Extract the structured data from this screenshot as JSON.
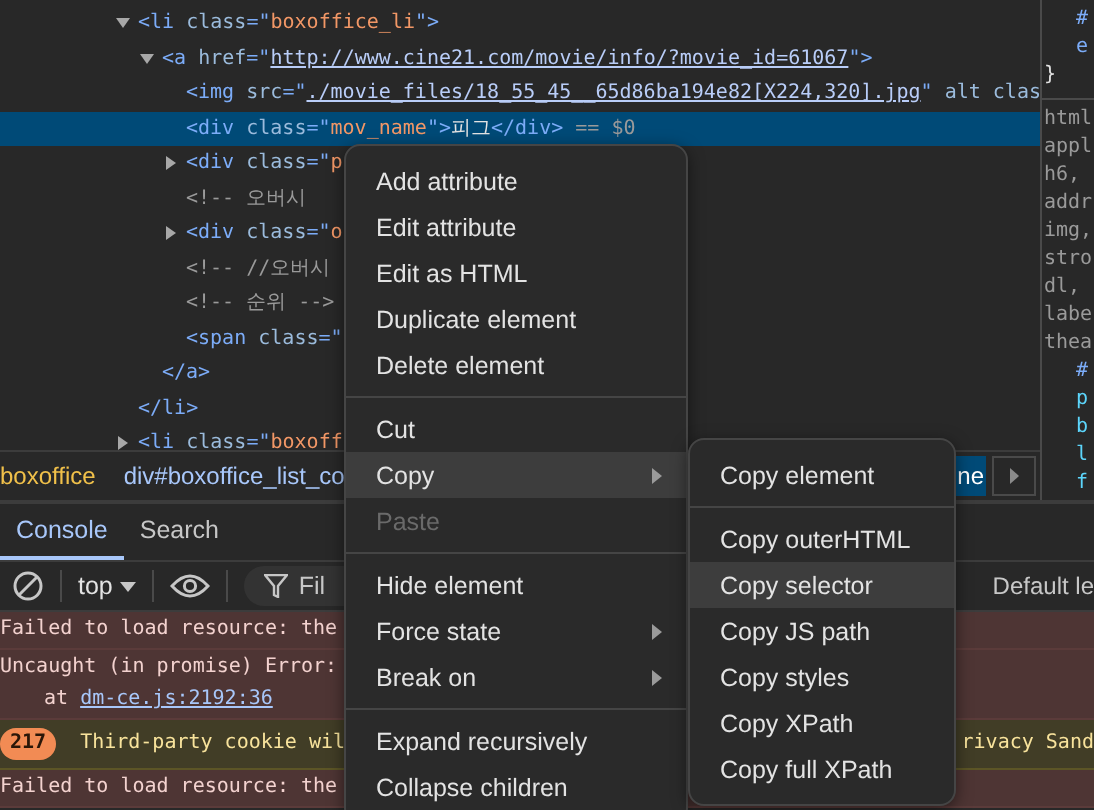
{
  "dom_tree": [
    {
      "selected": false,
      "expanded": true,
      "tokens": [
        {
          "kind": "tag",
          "text": "<li"
        },
        {
          "kind": "attr",
          "text": " class"
        },
        {
          "kind": "tag",
          "text": "=\""
        },
        {
          "kind": "value",
          "text": "boxoffice_li"
        },
        {
          "kind": "tag",
          "text": "\">"
        }
      ],
      "closing": "</li>",
      "children": [
        {
          "selected": false,
          "expanded": true,
          "tokens": [
            {
              "kind": "tag",
              "text": "<a"
            },
            {
              "kind": "attr",
              "text": " href"
            },
            {
              "kind": "tag",
              "text": "=\""
            },
            {
              "kind": "link",
              "text": "http://www.cine21.com/movie/info/?movie_id=61067"
            },
            {
              "kind": "tag",
              "text": "\">"
            }
          ],
          "closing": "</a>",
          "children": [
            {
              "selected": false,
              "tokens": [
                {
                  "kind": "tag",
                  "text": "<img"
                },
                {
                  "kind": "attr",
                  "text": " src"
                },
                {
                  "kind": "tag",
                  "text": "=\""
                },
                {
                  "kind": "link",
                  "text": "./movie_files/18_55_45__65d86ba194e82[X224,320].jpg"
                },
                {
                  "kind": "tag",
                  "text": "\""
                },
                {
                  "kind": "attr",
                  "text": " alt clas"
                }
              ]
            },
            {
              "selected": true,
              "tokens": [
                {
                  "kind": "tag",
                  "text": "<div"
                },
                {
                  "kind": "attr",
                  "text": " class"
                },
                {
                  "kind": "tag",
                  "text": "=\""
                },
                {
                  "kind": "value",
                  "text": "mov_name"
                },
                {
                  "kind": "tag",
                  "text": "\">"
                },
                {
                  "kind": "text",
                  "text": "피그"
                },
                {
                  "kind": "tag",
                  "text": "</div>"
                },
                {
                  "kind": "marker",
                  "text": " == $0"
                }
              ]
            },
            {
              "selected": false,
              "expanded": false,
              "tokens": [
                {
                  "kind": "tag",
                  "text": "<div"
                },
                {
                  "kind": "attr",
                  "text": " class"
                },
                {
                  "kind": "tag",
                  "text": "=\""
                },
                {
                  "kind": "value",
                  "text": "p"
                }
              ]
            },
            {
              "selected": false,
              "tokens": [
                {
                  "kind": "comment",
                  "text": "<!-- 오버시"
                }
              ]
            },
            {
              "selected": false,
              "expanded": false,
              "tokens": [
                {
                  "kind": "tag",
                  "text": "<div"
                },
                {
                  "kind": "attr",
                  "text": " class"
                },
                {
                  "kind": "tag",
                  "text": "=\""
                },
                {
                  "kind": "value",
                  "text": "o"
                }
              ]
            },
            {
              "selected": false,
              "tokens": [
                {
                  "kind": "comment",
                  "text": "<!-- //오버시"
                }
              ]
            },
            {
              "selected": false,
              "tokens": [
                {
                  "kind": "comment",
                  "text": "<!-- 순위 -->"
                }
              ]
            },
            {
              "selected": false,
              "tokens": [
                {
                  "kind": "tag",
                  "text": "<span"
                },
                {
                  "kind": "attr",
                  "text": " class"
                },
                {
                  "kind": "tag",
                  "text": "=\""
                }
              ]
            }
          ]
        }
      ]
    },
    {
      "selected": false,
      "expanded": false,
      "tokens": [
        {
          "kind": "tag",
          "text": "<li"
        },
        {
          "kind": "attr",
          "text": " class"
        },
        {
          "kind": "tag",
          "text": "=\""
        },
        {
          "kind": "value",
          "text": "boxoff"
        }
      ]
    }
  ],
  "breadcrumbs": [
    {
      "text": "boxoffice",
      "kind": "id",
      "selected": false
    },
    {
      "text": "div#boxoffice_list_co",
      "kind": "element",
      "selected": false
    },
    {
      "text": "ne",
      "kind": "element",
      "selected": true
    }
  ],
  "styles_pane": {
    "sections": [
      {
        "lines": [
          {
            "kind": "declaration",
            "text": "#"
          },
          {
            "kind": "declaration",
            "text": "e"
          },
          {
            "kind": "brace",
            "text": "}"
          }
        ]
      },
      {
        "lines": [
          {
            "kind": "user_agent",
            "text": "html"
          },
          {
            "kind": "user_agent",
            "text": "appl"
          },
          {
            "kind": "user_agent",
            "text": "h6,"
          },
          {
            "kind": "user_agent",
            "text": "addr"
          },
          {
            "kind": "user_agent",
            "text": "img,"
          },
          {
            "kind": "user_agent",
            "text": "stro"
          },
          {
            "kind": "user_agent",
            "text": "dl,"
          },
          {
            "kind": "user_agent",
            "text": "labe"
          },
          {
            "kind": "user_agent",
            "text": "thea"
          },
          {
            "kind": "declaration",
            "text": "#"
          },
          {
            "kind": "property",
            "text": "p"
          },
          {
            "kind": "property",
            "text": "b"
          },
          {
            "kind": "property",
            "text": "l"
          },
          {
            "kind": "property",
            "text": "f"
          }
        ]
      }
    ]
  },
  "drawer_tabs": [
    {
      "label": "Console",
      "selected": true
    },
    {
      "label": "Search",
      "selected": false
    }
  ],
  "console_toolbar": {
    "context": "top",
    "filter": {
      "placeholder": "Fil"
    },
    "levels": "Default le"
  },
  "console_messages": [
    {
      "kind": "error",
      "text": "Failed to load resource: the"
    },
    {
      "kind": "error",
      "text": "Uncaught (in promise) Error:",
      "stack_prefix": "at",
      "stack_link": "dm-ce.js:2192:36"
    },
    {
      "kind": "warning",
      "count": "217",
      "text": "Third-party cookie wil",
      "text_right": "rivacy Sand"
    },
    {
      "kind": "error",
      "text": "Failed to load resource: the"
    }
  ],
  "context_menu": {
    "groups": [
      [
        {
          "label": "Add attribute",
          "selected": false,
          "disabled": false,
          "submenu": false
        },
        {
          "label": "Edit attribute",
          "selected": false,
          "disabled": false,
          "submenu": false
        },
        {
          "label": "Edit as HTML",
          "selected": false,
          "disabled": false,
          "submenu": false
        },
        {
          "label": "Duplicate element",
          "selected": false,
          "disabled": false,
          "submenu": false
        },
        {
          "label": "Delete element",
          "selected": false,
          "disabled": false,
          "submenu": false
        }
      ],
      [
        {
          "label": "Cut",
          "selected": false,
          "disabled": false,
          "submenu": false
        },
        {
          "label": "Copy",
          "selected": true,
          "disabled": false,
          "submenu": true
        },
        {
          "label": "Paste",
          "selected": false,
          "disabled": true,
          "submenu": false
        }
      ],
      [
        {
          "label": "Hide element",
          "selected": false,
          "disabled": false,
          "submenu": false
        },
        {
          "label": "Force state",
          "selected": false,
          "disabled": false,
          "submenu": true
        },
        {
          "label": "Break on",
          "selected": false,
          "disabled": false,
          "submenu": true
        }
      ],
      [
        {
          "label": "Expand recursively",
          "selected": false,
          "disabled": false,
          "submenu": false
        },
        {
          "label": "Collapse children",
          "selected": false,
          "disabled": false,
          "submenu": false
        }
      ]
    ]
  },
  "copy_submenu": {
    "groups": [
      [
        {
          "label": "Copy element",
          "selected": false,
          "disabled": false,
          "submenu": false
        }
      ],
      [
        {
          "label": "Copy outerHTML",
          "selected": false,
          "disabled": false,
          "submenu": false
        },
        {
          "label": "Copy selector",
          "selected": true,
          "disabled": false,
          "submenu": false
        },
        {
          "label": "Copy JS path",
          "selected": false,
          "disabled": false,
          "submenu": false
        },
        {
          "label": "Copy styles",
          "selected": false,
          "disabled": false,
          "submenu": false
        },
        {
          "label": "Copy XPath",
          "selected": false,
          "disabled": false,
          "submenu": false
        },
        {
          "label": "Copy full XPath",
          "selected": false,
          "disabled": false,
          "submenu": false
        }
      ]
    ]
  }
}
